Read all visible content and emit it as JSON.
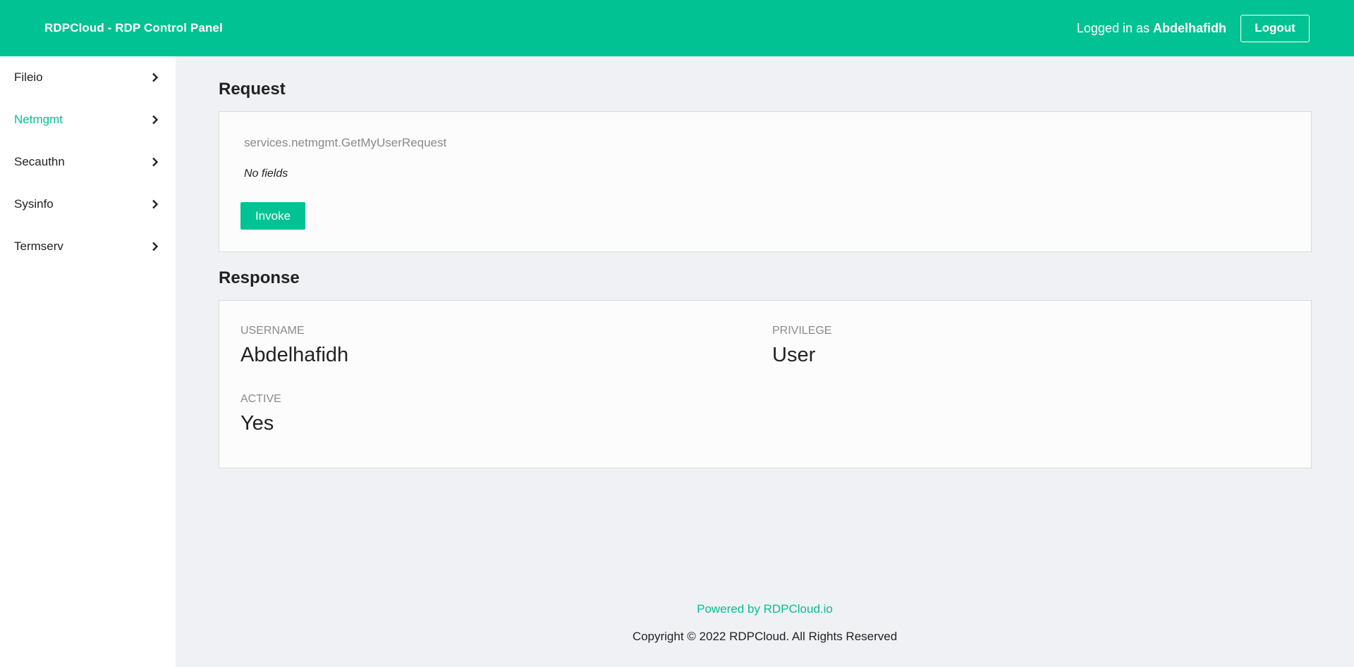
{
  "header": {
    "brand": "RDPCloud - RDP Control Panel",
    "logged_in_prefix": "Logged in as",
    "username": "Abdelhafidh",
    "logout_label": "Logout"
  },
  "sidebar": {
    "items": [
      {
        "label": "Fileio",
        "active": false
      },
      {
        "label": "Netmgmt",
        "active": true
      },
      {
        "label": "Secauthn",
        "active": false
      },
      {
        "label": "Sysinfo",
        "active": false
      },
      {
        "label": "Termserv",
        "active": false
      }
    ]
  },
  "request": {
    "title": "Request",
    "name": "services.netmgmt.GetMyUserRequest",
    "no_fields": "No fields",
    "invoke_label": "Invoke"
  },
  "response": {
    "title": "Response",
    "fields": [
      {
        "label": "USERNAME",
        "value": "Abdelhafidh"
      },
      {
        "label": "PRIVILEGE",
        "value": "User"
      },
      {
        "label": "ACTIVE",
        "value": "Yes"
      }
    ]
  },
  "footer": {
    "powered_by": "Powered by RDPCloud.io",
    "copyright": "Copyright © 2022 RDPCloud. All Rights Reserved"
  },
  "colors": {
    "accent": "#00c292",
    "background": "#f0f1f5"
  }
}
